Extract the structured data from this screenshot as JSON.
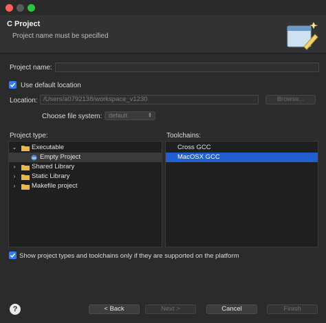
{
  "window": {
    "title": "C Project",
    "message": "Project name must be specified"
  },
  "form": {
    "project_name_label": "Project name:",
    "project_name_value": "",
    "use_default_location_label": "Use default location",
    "use_default_location_checked": true,
    "location_label": "Location:",
    "location_value": "/Users/a0792138/workspace_v1230",
    "browse_label": "Browse...",
    "file_system_label": "Choose file system:",
    "file_system_value": "default"
  },
  "project_type": {
    "label": "Project type:",
    "items": [
      {
        "label": "Executable",
        "expanded": true
      },
      {
        "label": "Empty Project",
        "child": true
      },
      {
        "label": "Shared Library",
        "expanded": false
      },
      {
        "label": "Static Library",
        "expanded": false
      },
      {
        "label": "Makefile project",
        "expanded": false
      }
    ]
  },
  "toolchains": {
    "label": "Toolchains:",
    "items": [
      {
        "label": "Cross GCC"
      },
      {
        "label": "MacOSX GCC",
        "selected": true
      }
    ]
  },
  "filter": {
    "label": "Show project types and toolchains only if they are supported on the platform",
    "checked": true
  },
  "buttons": {
    "help": "?",
    "back": "< Back",
    "next": "Next >",
    "cancel": "Cancel",
    "finish": "Finish"
  },
  "colors": {
    "accent": "#2f7ff2",
    "selection": "#1f5fce",
    "folder": "#e9b84a"
  }
}
